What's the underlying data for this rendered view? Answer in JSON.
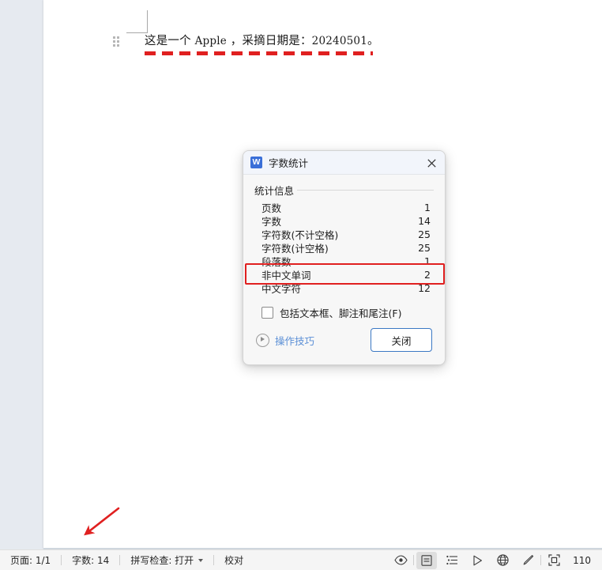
{
  "document": {
    "paragraph_prefix": "这是一个 ",
    "paragraph_latin": "Apple",
    "paragraph_middle": " ，采摘日期是：",
    "paragraph_date": "20240501",
    "paragraph_suffix": "。",
    "full_text": "这是一个 Apple ，采摘日期是： 20240501。",
    "annotation_underline_color": "#e02020",
    "annotation_arrow_color": "#e02020"
  },
  "dialog": {
    "app_icon": "wps-writer-icon",
    "app_icon_letter": "W",
    "title": "字数统计",
    "close_icon": "close-icon",
    "group_label": "统计信息",
    "stats": [
      {
        "label": "页数",
        "value": "1"
      },
      {
        "label": "字数",
        "value": "14"
      },
      {
        "label": "字符数(不计空格)",
        "value": "25"
      },
      {
        "label": "字符数(计空格)",
        "value": "25"
      },
      {
        "label": "段落数",
        "value": "1"
      },
      {
        "label": "非中文单词",
        "value": "2"
      },
      {
        "label": "中文字符",
        "value": "12"
      }
    ],
    "highlighted_row_index": 3,
    "highlight_color": "#e02020",
    "checkbox": {
      "label": "包括文本框、脚注和尾注(F)",
      "checked": false
    },
    "tips": {
      "icon": "play-circle-icon",
      "label": "操作技巧",
      "color": "#5b8fd6"
    },
    "close_button": {
      "label": "关闭",
      "accent": "#3b78c4"
    }
  },
  "statusbar": {
    "page": "页面: 1/1",
    "words": "字数: 14",
    "spellcheck": "拼写检查: 打开",
    "spellcheck_caret": "chevron-down-icon",
    "proofread": "校对",
    "icons": [
      {
        "name": "eye-icon",
        "glyph": "◎",
        "active": false
      },
      {
        "name": "page-layout-view-icon",
        "glyph": "▤",
        "active": true
      },
      {
        "name": "outline-view-icon",
        "glyph": "☰",
        "active": false
      },
      {
        "name": "play-view-icon",
        "glyph": "▷",
        "active": false
      },
      {
        "name": "web-layout-view-icon",
        "glyph": "⊕",
        "active": false
      },
      {
        "name": "pen-icon",
        "glyph": "✎",
        "active": false
      },
      {
        "name": "fit-page-icon",
        "glyph": "⛶",
        "active": false
      }
    ],
    "zoom": "110"
  }
}
